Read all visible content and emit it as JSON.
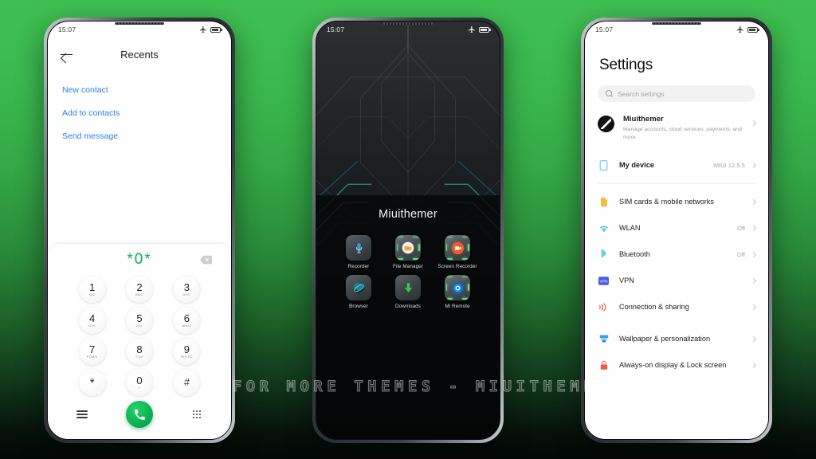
{
  "background": {
    "top_color": "#3fbf52",
    "bottom_color": "#040806"
  },
  "watermark": {
    "text": "VISIT  FOR  MORE  THEMES  -  MIUITHEMER.COM"
  },
  "status_bar": {
    "time": "15:07",
    "airplane_icon": "airplane-icon",
    "battery_icon": "battery-icon"
  },
  "phone1": {
    "title": "Recents",
    "back_icon": "back-arrow-icon",
    "links": [
      {
        "label": "New contact"
      },
      {
        "label": "Add to contacts"
      },
      {
        "label": "Send message"
      }
    ],
    "dialed_number": "*0*",
    "number_color": "#00b050",
    "backspace_icon": "backspace-icon",
    "keys": [
      {
        "digit": "1",
        "letters": "QD"
      },
      {
        "digit": "2",
        "letters": "ABC"
      },
      {
        "digit": "3",
        "letters": "DEF"
      },
      {
        "digit": "4",
        "letters": "GHI"
      },
      {
        "digit": "5",
        "letters": "JKL"
      },
      {
        "digit": "6",
        "letters": "MNO"
      },
      {
        "digit": "7",
        "letters": "PQRS"
      },
      {
        "digit": "8",
        "letters": "TUV"
      },
      {
        "digit": "9",
        "letters": "WXYZ"
      },
      {
        "digit": "*",
        "letters": ""
      },
      {
        "digit": "0",
        "letters": "+"
      },
      {
        "digit": "#",
        "letters": ""
      }
    ],
    "menu_icon": "menu-icon",
    "call_icon": "call-icon",
    "keypad_icon": "keypad-grid-icon"
  },
  "phone2": {
    "folder_name": "Miuithemer",
    "apps": [
      {
        "label": "Recorder",
        "icon": "microphone-icon"
      },
      {
        "label": "File Manager",
        "icon": "folder-icon"
      },
      {
        "label": "Screen Recorder",
        "icon": "video-camera-icon"
      },
      {
        "label": "Browser",
        "icon": "browser-globe-icon"
      },
      {
        "label": "Downloads",
        "icon": "download-arrow-icon"
      },
      {
        "label": "Mi Remote",
        "icon": "remote-target-icon"
      }
    ]
  },
  "phone3": {
    "title": "Settings",
    "search": {
      "placeholder": "Search settings",
      "icon": "search-icon"
    },
    "account": {
      "name": "Miuithemer",
      "subtitle": "Manage accounts, cloud services, payments, and more",
      "avatar": "account-avatar"
    },
    "rows": [
      {
        "label": "My device",
        "value": "MIUI 12.5.5",
        "icon": "device-icon",
        "bold": true
      },
      {
        "label": "SIM cards & mobile networks",
        "value": "",
        "icon": "sim-card-icon",
        "bold": false
      },
      {
        "label": "WLAN",
        "value": "Off",
        "icon": "wifi-icon",
        "bold": false
      },
      {
        "label": "Bluetooth",
        "value": "Off",
        "icon": "bluetooth-icon",
        "bold": false
      },
      {
        "label": "VPN",
        "value": "",
        "icon": "vpn-icon",
        "bold": false
      },
      {
        "label": "Connection & sharing",
        "value": "",
        "icon": "connection-sharing-icon",
        "bold": false
      },
      {
        "label": "Wallpaper & personalization",
        "value": "",
        "icon": "wallpaper-icon",
        "bold": false
      },
      {
        "label": "Always-on display & Lock screen",
        "value": "",
        "icon": "lock-icon",
        "bold": false
      }
    ]
  }
}
